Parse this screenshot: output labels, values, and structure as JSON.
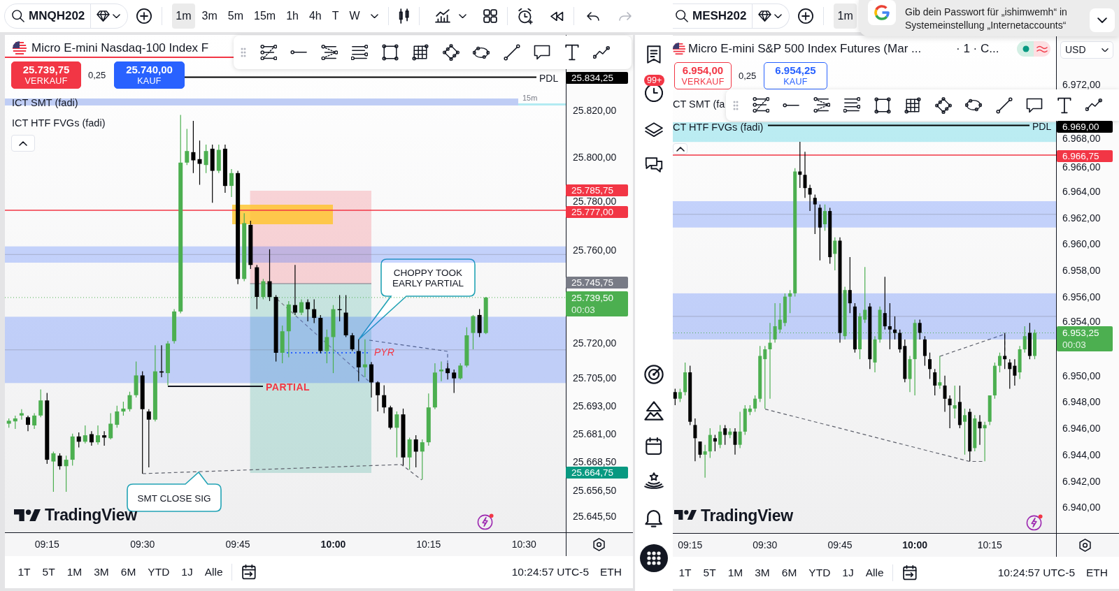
{
  "left_chart": {
    "toolbar": {
      "symbol": "MNQH202",
      "intervals": [
        {
          "label": "1m",
          "selected": true
        },
        {
          "label": "3m",
          "selected": false
        },
        {
          "label": "5m",
          "selected": false
        },
        {
          "label": "15m",
          "selected": false
        },
        {
          "label": "1h",
          "selected": false
        },
        {
          "label": "4h",
          "selected": false
        },
        {
          "label": "T",
          "selected": false
        },
        {
          "label": "W",
          "selected": false
        }
      ],
      "history": [
        {
          "disabled": false
        },
        {
          "disabled": true
        }
      ]
    },
    "header": {
      "title": "Micro E-mini Nasdaq-100 Index F",
      "orders": [
        {
          "kind": "filled",
          "color": "#f23645",
          "price": "25.739,75",
          "label": "VERKAUF"
        },
        {
          "kind": "filled",
          "color": "#2962ff",
          "price": "25.740,00",
          "label": "KAUF"
        }
      ],
      "spread": "0,25"
    },
    "indicators": [
      "ICT SMT (fadi)",
      "ICT HTF FVGs (fadi)"
    ],
    "interval_tag": "15m",
    "notes": [
      {
        "kind": "callout",
        "text": "CHOPPY TOOK\nEARLY PARTIAL"
      },
      {
        "kind": "callout",
        "text": "SMT CLOSE SIG"
      },
      {
        "kind": "strong",
        "text": "PARTIAL"
      },
      {
        "kind": "emphasis",
        "text": "PYR"
      }
    ],
    "brand": "TradingView",
    "price_tags": [
      {
        "text": "25.834,25",
        "color": "#000000"
      },
      {
        "text": "25.785,75",
        "color": "#f23645"
      },
      {
        "text": "25.777,00",
        "color": "#f23645"
      },
      {
        "text": "25.745,75",
        "color": "#787b86"
      },
      {
        "text": "25.739,50",
        "countdown": "00:03",
        "color": "#4caf50"
      },
      {
        "text": "25.664,75",
        "color": "#089981"
      }
    ],
    "chart_data": {
      "type": "candlestick",
      "xlim": [
        548.37,
        647.13
      ],
      "ylim": [
        25638.54,
        25852.42
      ],
      "yticks": [
        {
          "value": 25820,
          "label": "25.820,00"
        },
        {
          "value": 25800,
          "label": "25.800,00"
        },
        {
          "value": 25780,
          "label": "25.780,00"
        },
        {
          "value": 25760,
          "label": "25.760,00"
        },
        {
          "value": 25720,
          "label": "25.720,00"
        },
        {
          "value": 25705,
          "label": "25.705,00"
        },
        {
          "value": 25693,
          "label": "25.693,00"
        },
        {
          "value": 25681,
          "label": "25.681,00"
        },
        {
          "value": 25668.5,
          "label": "25.668,50"
        },
        {
          "value": 25656.5,
          "label": "25.656,50"
        },
        {
          "value": 25645.5,
          "label": "25.645,50"
        }
      ],
      "xticks": [
        {
          "value": 555,
          "label": "09:15"
        },
        {
          "value": 570,
          "label": "09:30"
        },
        {
          "value": 585,
          "label": "09:45"
        },
        {
          "value": 600,
          "label": "10:00"
        },
        {
          "value": 615,
          "label": "10:15"
        },
        {
          "value": 630,
          "label": "10:30"
        }
      ],
      "bands": [
        {
          "axis": "y",
          "from": 25754.5,
          "to": 25761.5,
          "color": "#2962ff"
        },
        {
          "axis": "y",
          "from": 25702.75,
          "to": 25731.25,
          "color": "#2962ff"
        }
      ],
      "ref_lines": [
        {
          "axis": "y",
          "value": 25834.25,
          "label": "PDL",
          "color": "#000000"
        },
        {
          "axis": "y",
          "value": 25777,
          "color": "#f23645"
        },
        {
          "axis": "y",
          "value": 25758,
          "color": "#787b86"
        },
        {
          "axis": "y",
          "value": 25739.5,
          "color": "#4caf50"
        },
        {
          "axis": "y",
          "value": 25717,
          "color": "#787b86"
        }
      ],
      "x": [
        549,
        550,
        551,
        552,
        553,
        554,
        555,
        556,
        557,
        558,
        559,
        560,
        561,
        562,
        563,
        564,
        565,
        566,
        567,
        568,
        569,
        570,
        571,
        572,
        573,
        574,
        575,
        576,
        577,
        578,
        579,
        580,
        581,
        582,
        583,
        584,
        585,
        586,
        587,
        588,
        589,
        590,
        591,
        592,
        593,
        594,
        595,
        596,
        597,
        598,
        599,
        600,
        601,
        602,
        603,
        604,
        605,
        606,
        607,
        608,
        609,
        610,
        611,
        612,
        613,
        614,
        615,
        616,
        617,
        618,
        619,
        620,
        621,
        622,
        623,
        624
      ],
      "ohlc": [
        [
          25685.25,
          25687.5,
          25683.5,
          25686.5
        ],
        [
          25686.25,
          25688.75,
          25683,
          25687.5
        ],
        [
          25688.75,
          25691.5,
          25687,
          25689.75
        ],
        [
          25688,
          25688.75,
          25682,
          25684.75
        ],
        [
          25684.5,
          25689.75,
          25683,
          25688.75
        ],
        [
          25688.75,
          25700,
          25688,
          25695.25
        ],
        [
          25695.25,
          25698.5,
          25668,
          25669.75
        ],
        [
          25669,
          25673.25,
          25656,
          25672.5
        ],
        [
          25671.5,
          25672.5,
          25665.5,
          25667
        ],
        [
          25667,
          25671.5,
          25656,
          25669.75
        ],
        [
          25669.75,
          25681,
          25667.25,
          25679.75
        ],
        [
          25679.75,
          25681.5,
          25675,
          25677.5
        ],
        [
          25677.5,
          25684.5,
          25676.75,
          25680.25
        ],
        [
          25680.75,
          25682,
          25675.75,
          25677.25
        ],
        [
          25677.25,
          25684.5,
          25676.25,
          25680.25
        ],
        [
          25680.25,
          25682,
          25675.75,
          25679.25
        ],
        [
          25679,
          25689.75,
          25678.5,
          25685.25
        ],
        [
          25684.75,
          25693,
          25683.5,
          25690.5
        ],
        [
          25690.5,
          25694.75,
          25688.75,
          25691.75
        ],
        [
          25691.5,
          25699,
          25690.5,
          25697.5
        ],
        [
          25697.5,
          25712,
          25696.5,
          25706
        ],
        [
          25706,
          25707.75,
          25663.75,
          25691.5
        ],
        [
          25690.5,
          25691.5,
          25666.5,
          25687
        ],
        [
          25687,
          25719,
          25686.25,
          25707.75
        ],
        [
          25707.75,
          25719,
          25705.25,
          25707.25
        ],
        [
          25707,
          25720.75,
          25701.75,
          25719.75
        ],
        [
          25720.75,
          25734.5,
          25719.75,
          25733.5
        ],
        [
          25733.5,
          25818,
          25732.75,
          25797.5
        ],
        [
          25797.5,
          25812,
          25796.5,
          25802.5
        ],
        [
          25802,
          25815.5,
          25793,
          25798.5
        ],
        [
          25799,
          25807,
          25788,
          25797
        ],
        [
          25796.5,
          25805.25,
          25793,
          25802.5
        ],
        [
          25803.5,
          25805.25,
          25780.25,
          25794
        ],
        [
          25794,
          25805.25,
          25793,
          25803
        ],
        [
          25803.5,
          25805.25,
          25784.5,
          25787.5
        ],
        [
          25787.5,
          25794.75,
          25782.75,
          25793
        ],
        [
          25793,
          25794,
          25745.25,
          25747.5
        ],
        [
          25747.5,
          25775.75,
          25746.5,
          25771.5
        ],
        [
          25770.75,
          25772.5,
          25751.75,
          25753.5
        ],
        [
          25752.5,
          25753.5,
          25734.5,
          25739.75
        ],
        [
          25739.75,
          25747.5,
          25738.75,
          25746.5
        ],
        [
          25746.5,
          25760.25,
          25738,
          25739.75
        ],
        [
          25739.75,
          25740.5,
          25712,
          25715.75
        ],
        [
          25715.75,
          25727.5,
          25711.25,
          25725
        ],
        [
          25725,
          25738,
          25713.75,
          25736.5
        ],
        [
          25736.25,
          25753.5,
          25732,
          25733
        ],
        [
          25733,
          25738.75,
          25732,
          25737.5
        ],
        [
          25737.5,
          25738.75,
          25729.25,
          25734.5
        ],
        [
          25734.5,
          25738.75,
          25728.5,
          25730.75
        ],
        [
          25730.75,
          25732,
          25715.5,
          25716.5
        ],
        [
          25716.5,
          25725.75,
          25711.25,
          25722.5
        ],
        [
          25722.5,
          25736.25,
          25707,
          25734.5
        ],
        [
          25734.5,
          25740.5,
          25729.25,
          25734.25
        ],
        [
          25733,
          25740.5,
          25722.5,
          25723.25
        ],
        [
          25723.25,
          25724.25,
          25716.5,
          25717.25
        ],
        [
          25716.5,
          25721.5,
          25703.5,
          25709.5
        ],
        [
          25709.5,
          25721.5,
          25705.25,
          25710.75
        ],
        [
          25710.75,
          25711.75,
          25696.5,
          25703
        ],
        [
          25703,
          25703.5,
          25690.5,
          25697.5
        ],
        [
          25697.5,
          25701.75,
          25689.75,
          25692.25
        ],
        [
          25692.25,
          25693,
          25682.75,
          25683.5
        ],
        [
          25683.5,
          25690.5,
          25670.75,
          25689.25
        ],
        [
          25689.25,
          25691.75,
          25667.25,
          25670.75
        ],
        [
          25670.75,
          25679.25,
          25665.5,
          25678.5
        ],
        [
          25678.5,
          25680.25,
          25666.5,
          25673.25
        ],
        [
          25673.25,
          25678.5,
          25661.25,
          25677.25
        ],
        [
          25677.25,
          25698.25,
          25675.75,
          25692.25
        ],
        [
          25692.25,
          25711.25,
          25691.5,
          25707.25
        ],
        [
          25707.75,
          25712,
          25703.5,
          25708.5
        ],
        [
          25709,
          25711.25,
          25704.25,
          25707
        ],
        [
          25707.25,
          25708.5,
          25698.5,
          25704.75
        ],
        [
          25704.75,
          25711.25,
          25704.25,
          25710.25
        ],
        [
          25710.25,
          25726.75,
          25709.5,
          25723.25
        ],
        [
          25724.25,
          25732,
          25717.25,
          25731.5
        ],
        [
          25732,
          25734.5,
          25722.5,
          25724.25
        ],
        [
          25724.25,
          25739.75,
          25723.75,
          25739.5
        ]
      ]
    },
    "ranges": [
      "1T",
      "5T",
      "1M",
      "3M",
      "6M",
      "YTD",
      "1J",
      "Alle"
    ],
    "clock": "10:24:57 UTC-5",
    "session": "ETH"
  },
  "sidebar": {
    "alerts_count": "99+"
  },
  "right_chart": {
    "toolbar": {
      "symbol": "MESH202",
      "intervals": [
        {
          "label": "1m",
          "selected": true
        }
      ]
    },
    "header": {
      "title": "Micro E-mini S&P 500 Index Futures (Mar ...",
      "meta": "· 1 · C...",
      "currency": "USD",
      "orders": [
        {
          "kind": "outline",
          "color": "#f23645",
          "price": "6.954,00",
          "label": "VERKAUF"
        },
        {
          "kind": "outline",
          "color": "#2962ff",
          "price": "6.954,25",
          "label": "KAUF"
        }
      ],
      "spread": "0,25"
    },
    "indicators": [
      "CT SMT (fa",
      "CT HTF FVGs (fadi)"
    ],
    "brand": "TradingView",
    "price_tags": [
      {
        "text": "6.969,00",
        "color": "#000000"
      },
      {
        "text": "6.966,75",
        "color": "#f23645"
      },
      {
        "text": "6.953,25",
        "countdown": "00:03",
        "color": "#4caf50"
      }
    ],
    "chart_data": {
      "type": "candlestick",
      "xlim": [
        551.54,
        640.87
      ],
      "ylim": [
        6938.05,
        6975.82
      ],
      "yticks": [
        {
          "value": 6972,
          "label": "6.972,00"
        },
        {
          "value": 6968,
          "label": "6.968,00"
        },
        {
          "value": 6966,
          "label": "6.966,00"
        },
        {
          "value": 6964,
          "label": "6.964,00"
        },
        {
          "value": 6962,
          "label": "6.962,00"
        },
        {
          "value": 6960,
          "label": "6.960,00"
        },
        {
          "value": 6958,
          "label": "6.958,00"
        },
        {
          "value": 6956,
          "label": "6.956,00"
        },
        {
          "value": 6954,
          "label": "6.954,00"
        },
        {
          "value": 6950,
          "label": "6.950,00"
        },
        {
          "value": 6948,
          "label": "6.948,00"
        },
        {
          "value": 6946,
          "label": "6.946,00"
        },
        {
          "value": 6944,
          "label": "6.944,00"
        },
        {
          "value": 6942,
          "label": "6.942,00"
        },
        {
          "value": 6940,
          "label": "6.940,00"
        }
      ],
      "xticks": [
        {
          "value": 555,
          "label": "09:15"
        },
        {
          "value": 570,
          "label": "09:30"
        },
        {
          "value": 585,
          "label": "09:45"
        },
        {
          "value": 600,
          "label": "10:00"
        },
        {
          "value": 615,
          "label": "10:15"
        }
      ],
      "bands": [
        {
          "axis": "y",
          "from": 6967.75,
          "to": 6969.25,
          "color": "#00bcd4"
        },
        {
          "axis": "y",
          "from": 6961.25,
          "to": 6963.25,
          "color": "#2962ff"
        },
        {
          "axis": "y",
          "from": 6952.75,
          "to": 6956.25,
          "color": "#2962ff"
        }
      ],
      "ref_lines": [
        {
          "axis": "y",
          "value": 6969,
          "label": "PDL",
          "color": "#000000"
        },
        {
          "axis": "y",
          "value": 6966.75,
          "color": "#f23645"
        },
        {
          "axis": "y",
          "value": 6962.25,
          "color": "#787b86"
        },
        {
          "axis": "y",
          "value": 6954.5,
          "color": "#787b86"
        },
        {
          "axis": "y",
          "value": 6953.25,
          "color": "#4caf50"
        }
      ],
      "x": [
        552,
        553,
        554,
        555,
        556,
        557,
        558,
        559,
        560,
        561,
        562,
        563,
        564,
        565,
        566,
        567,
        568,
        569,
        570,
        571,
        572,
        573,
        574,
        575,
        576,
        577,
        578,
        579,
        580,
        581,
        582,
        583,
        584,
        585,
        586,
        587,
        588,
        589,
        590,
        591,
        592,
        593,
        594,
        595,
        596,
        597,
        598,
        599,
        600,
        601,
        602,
        603,
        604,
        605,
        606,
        607,
        608,
        609,
        610,
        611,
        612,
        613,
        614,
        615,
        616,
        617,
        618,
        619,
        620,
        621,
        622,
        623,
        624
      ],
      "ohlc": [
        [
          6948.75,
          6949,
          6947.75,
          6948.25
        ],
        [
          6948.25,
          6949,
          6948,
          6948.75
        ],
        [
          6948.75,
          6951,
          6948.5,
          6950.25
        ],
        [
          6950.25,
          6950.75,
          6946.25,
          6946.5
        ],
        [
          6946.25,
          6946.75,
          6943.5,
          6945.25
        ],
        [
          6945,
          6945,
          6943.75,
          6944
        ],
        [
          6944,
          6944.75,
          6942.25,
          6944.25
        ],
        [
          6944.25,
          6946,
          6943.75,
          6945.5
        ],
        [
          6945.25,
          6945.5,
          6944.25,
          6945
        ],
        [
          6944.75,
          6946.25,
          6944.5,
          6945.75
        ],
        [
          6946,
          6946.25,
          6944.75,
          6945.5
        ],
        [
          6945.5,
          6946,
          6945.25,
          6945.75
        ],
        [
          6945.75,
          6946,
          6944,
          6944.75
        ],
        [
          6944.75,
          6947.25,
          6944.5,
          6945.75
        ],
        [
          6945.75,
          6947.75,
          6945.5,
          6947.5
        ],
        [
          6947.25,
          6947.75,
          6947,
          6947.5
        ],
        [
          6947.5,
          6948.5,
          6947.25,
          6948.25
        ],
        [
          6948.25,
          6952.25,
          6948,
          6951.5
        ],
        [
          6951.25,
          6952.25,
          6947.5,
          6952
        ],
        [
          6952,
          6954,
          6948.25,
          6952.5
        ],
        [
          6952.75,
          6955.5,
          6952.5,
          6953.75
        ],
        [
          6953.5,
          6955.5,
          6953.25,
          6954.25
        ],
        [
          6954,
          6956.25,
          6953.75,
          6956
        ],
        [
          6956,
          6956.5,
          6954.75,
          6956.25
        ],
        [
          6956.25,
          6965.75,
          6956,
          6965.5
        ],
        [
          6965.5,
          6967.75,
          6964.25,
          6965.25
        ],
        [
          6965.25,
          6967,
          6963.5,
          6964.25
        ],
        [
          6964.25,
          6964.5,
          6962.5,
          6963.75
        ],
        [
          6963.5,
          6963.75,
          6960.75,
          6963
        ],
        [
          6962.75,
          6963,
          6958.75,
          6961.25
        ],
        [
          6961.5,
          6963,
          6961,
          6962.5
        ],
        [
          6962.5,
          6962.75,
          6958.5,
          6959
        ],
        [
          6959.25,
          6960.5,
          6958,
          6960.25
        ],
        [
          6960.25,
          6960.5,
          6952.5,
          6953.25
        ],
        [
          6953,
          6956.75,
          6952.75,
          6956.5
        ],
        [
          6956.5,
          6959,
          6954.75,
          6955.5
        ],
        [
          6955.25,
          6955.5,
          6951.75,
          6952
        ],
        [
          6952,
          6954.75,
          6951.25,
          6954.5
        ],
        [
          6954.25,
          6958.25,
          6954,
          6955
        ],
        [
          6955.25,
          6955.5,
          6950.5,
          6951.25
        ],
        [
          6951,
          6953,
          6950.25,
          6952.75
        ],
        [
          6952.75,
          6955.25,
          6952.5,
          6955
        ],
        [
          6954.75,
          6957.5,
          6953.5,
          6953.75
        ],
        [
          6953.75,
          6955.5,
          6952,
          6953.5
        ],
        [
          6953.5,
          6954.5,
          6952.75,
          6953.25
        ],
        [
          6953.25,
          6953.5,
          6951.75,
          6952
        ],
        [
          6952.25,
          6952.75,
          6949.5,
          6949.75
        ],
        [
          6949.75,
          6951.5,
          6948.75,
          6951.25
        ],
        [
          6951.25,
          6954.25,
          6948.5,
          6954
        ],
        [
          6954,
          6954.25,
          6952.75,
          6953.25
        ],
        [
          6952.75,
          6953,
          6950.75,
          6951.5
        ],
        [
          6951.25,
          6951.75,
          6949.75,
          6950.5
        ],
        [
          6950.25,
          6950.5,
          6948.5,
          6949.25
        ],
        [
          6949.25,
          6951.5,
          6949,
          6949.5
        ],
        [
          6949.25,
          6950,
          6947.25,
          6948.25
        ],
        [
          6948.25,
          6948.5,
          6946,
          6947.75
        ],
        [
          6947.5,
          6949.25,
          6946.75,
          6947.75
        ],
        [
          6948,
          6949.25,
          6946,
          6946.25
        ],
        [
          6946.5,
          6947.5,
          6944,
          6947
        ],
        [
          6947.25,
          6947.5,
          6943.5,
          6944.25
        ],
        [
          6944.5,
          6947,
          6944.25,
          6946.75
        ],
        [
          6946.5,
          6947,
          6944.75,
          6946
        ],
        [
          6946,
          6946.5,
          6943.5,
          6946.25
        ],
        [
          6946.5,
          6948.5,
          6946.25,
          6948.5
        ],
        [
          6948.5,
          6951,
          6948.25,
          6950.75
        ],
        [
          6950.75,
          6951.75,
          6950.25,
          6951.5
        ],
        [
          6951.5,
          6953.25,
          6950.5,
          6951.25
        ],
        [
          6951,
          6951.25,
          6949,
          6950.5
        ],
        [
          6950.75,
          6951.25,
          6949.25,
          6950
        ],
        [
          6950.25,
          6952.25,
          6949.75,
          6952
        ],
        [
          6952,
          6953.75,
          6951.75,
          6953
        ],
        [
          6953.25,
          6954,
          6951.25,
          6951.5
        ],
        [
          6951.5,
          6953.5,
          6951.25,
          6953.25
        ]
      ]
    },
    "ranges": [
      "1T",
      "5T",
      "1M",
      "3M",
      "6M",
      "YTD",
      "1J",
      "Alle"
    ],
    "clock": "10:24:57 UTC-5",
    "session": "ETH"
  },
  "notification": {
    "lines": [
      "Gib dein Passwort für „ishimwemh“ in",
      "Systemeinstellung „Internetaccounts“"
    ]
  }
}
